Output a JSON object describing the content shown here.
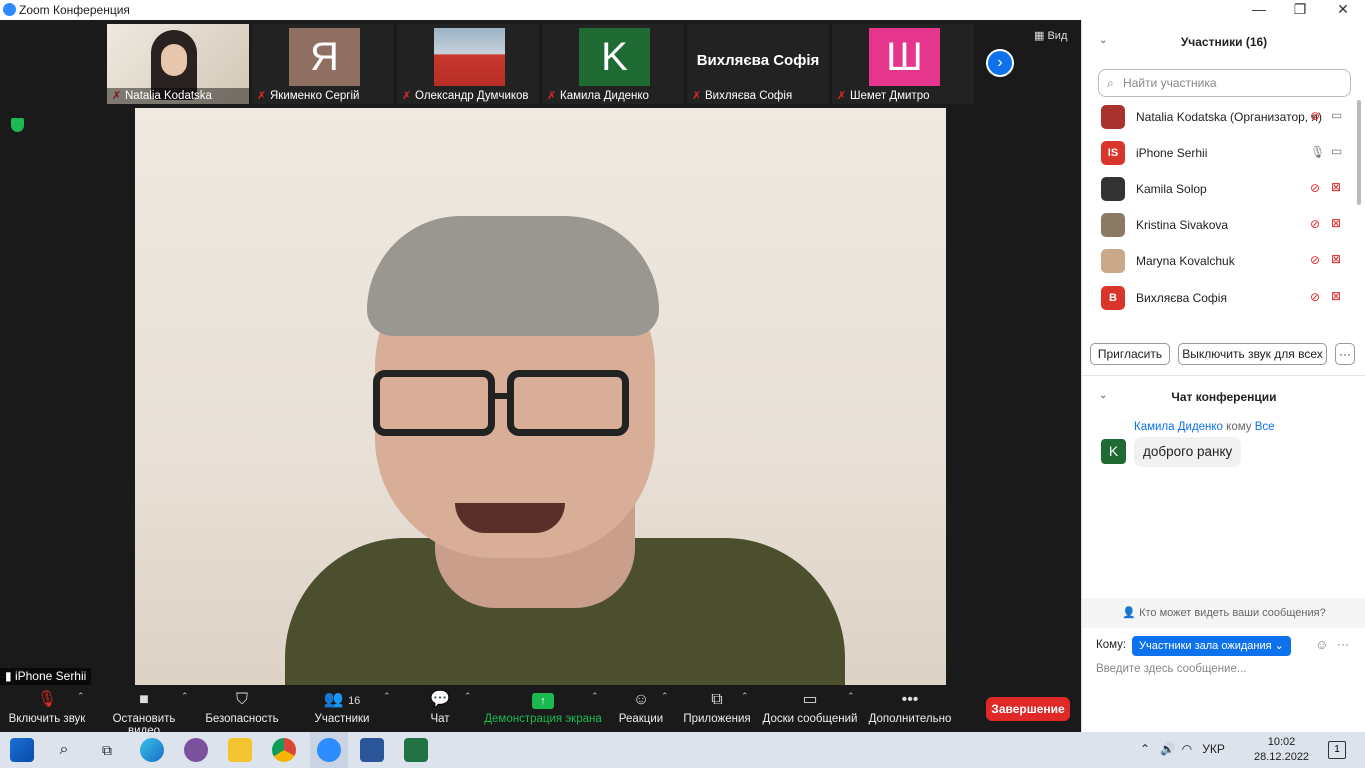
{
  "window": {
    "title": "Zoom Конференция",
    "minimize": "—",
    "maximize": "❐",
    "close": "✕"
  },
  "view_button": "Вид",
  "thumbnails": [
    {
      "name": "Natalia Kodatska",
      "avatar": "",
      "color": "#d9d2c7"
    },
    {
      "name": "Якименко Сергій",
      "avatar": "Я",
      "color": "#8e6f62"
    },
    {
      "name": "Олександр Думчиков",
      "avatar": "",
      "color": "#6c8aa6"
    },
    {
      "name": "Камила Диденко",
      "avatar": "K",
      "color": "#1f6b33"
    },
    {
      "name": "Вихляєва Софія",
      "avatar": "",
      "text": "Вихляєва Софія",
      "color": "#222"
    },
    {
      "name": "Шемет Дмитро",
      "avatar": "Ш",
      "color": "#e6358d"
    }
  ],
  "speaker_label": "iPhone Serhii",
  "toolbar": {
    "unmute": "Включить звук",
    "stop_video": "Остановить видео",
    "security": "Безопасность",
    "participants": "Участники",
    "participants_count": "16",
    "chat": "Чат",
    "share": "Демонстрация экрана",
    "reactions": "Реакции",
    "apps": "Приложения",
    "whiteboards": "Доски сообщений",
    "more": "Дополнительно",
    "end": "Завершение"
  },
  "participants_panel": {
    "title": "Участники (16)",
    "search_placeholder": "Найти участника",
    "list": [
      {
        "name": "Natalia Kodatska (Организатор, я)",
        "initials": "",
        "color": "#a8322d",
        "mic": "muted",
        "cam": "on"
      },
      {
        "name": "iPhone Serhii",
        "initials": "IS",
        "color": "#d9352a",
        "mic": "on",
        "cam": "on"
      },
      {
        "name": "Kamila Solop",
        "initials": "",
        "color": "#333333",
        "mic": "muted",
        "cam": "off"
      },
      {
        "name": "Kristina Sivakova",
        "initials": "",
        "color": "#8a7a66",
        "mic": "muted",
        "cam": "off"
      },
      {
        "name": "Maryna Kovalchuk",
        "initials": "",
        "color": "#c9a98a",
        "mic": "muted",
        "cam": "off"
      },
      {
        "name": "Вихляєва Софія",
        "initials": "B",
        "color": "#d9352a",
        "mic": "muted",
        "cam": "off"
      }
    ],
    "invite": "Пригласить",
    "mute_all": "Выключить звук для всех",
    "more": "···"
  },
  "chat_panel": {
    "title": "Чат конференции",
    "sender": "Камила Диденко",
    "to_word": "кому",
    "recipient": "Все",
    "sender_initial": "K",
    "message": "доброго ранку",
    "who_can_see": "Кто может видеть ваши сообщения?",
    "to_label": "Кому:",
    "to_value": "Участники зала ожидания",
    "input_placeholder": "Введите здесь сообщение..."
  },
  "taskbar": {
    "language": "УКР",
    "time": "10:02",
    "date": "28.12.2022",
    "notifications": "1"
  },
  "colors": {
    "zoom_blue": "#0e72ed",
    "end_red": "#e02828",
    "share_green": "#1cb851",
    "muted_red": "#e02828"
  }
}
